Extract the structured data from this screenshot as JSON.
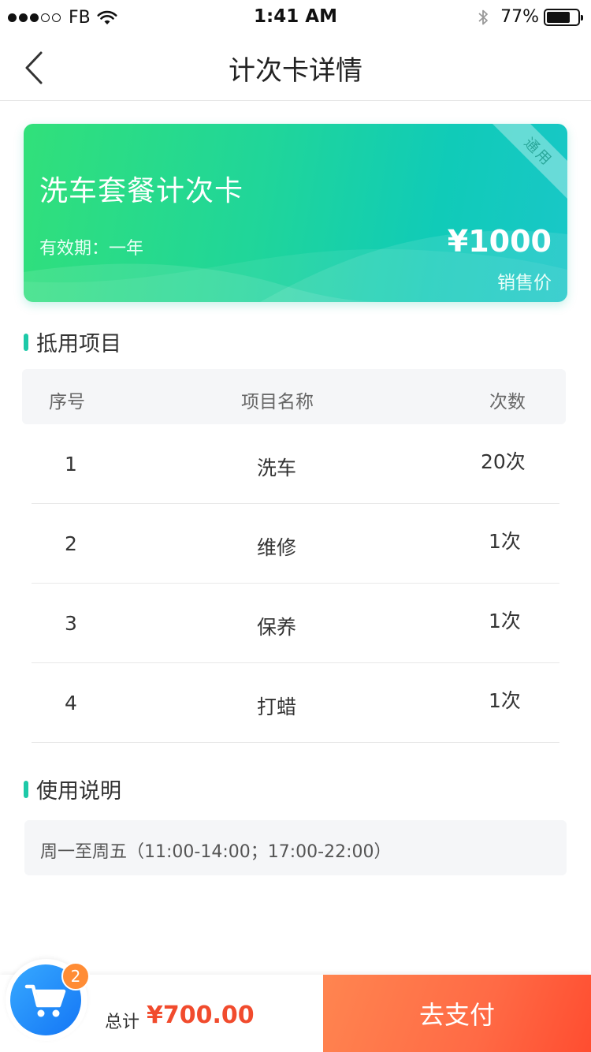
{
  "status_bar": {
    "carrier": "FB",
    "time": "1:41 AM",
    "battery_percent": "77%",
    "battery_level": 0.77
  },
  "nav": {
    "title": "计次卡详情",
    "back_icon": "chevron-left-icon"
  },
  "card": {
    "title": "洗车套餐计次卡",
    "validity": "有效期：一年",
    "price": "¥1000",
    "price_label": "销售价",
    "ribbon": "通用"
  },
  "items_section": {
    "title": "抵用项目",
    "columns": [
      "序号",
      "项目名称",
      "次数"
    ],
    "rows": [
      {
        "no": "1",
        "name": "洗车",
        "count": "20次"
      },
      {
        "no": "2",
        "name": "维修",
        "count": "1次"
      },
      {
        "no": "3",
        "name": "保养",
        "count": "1次"
      },
      {
        "no": "4",
        "name": "打蜡",
        "count": "1次"
      }
    ]
  },
  "usage_section": {
    "title": "使用说明",
    "text": "周一至周五（11:00-14:00；17:00-22:00）"
  },
  "bottom": {
    "cart_badge": "2",
    "total_label": "总计",
    "total_value": "¥700.00",
    "pay_label": "去支付"
  },
  "colors": {
    "accent": "#1dc9a8",
    "price": "#f14b2d",
    "cart": "#1e86f8",
    "pay": "#ff6a45"
  }
}
